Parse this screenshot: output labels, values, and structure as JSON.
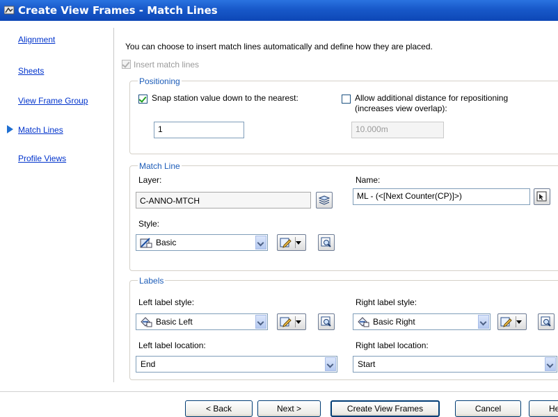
{
  "window": {
    "title": "Create View Frames - Match Lines"
  },
  "nav": {
    "items": [
      {
        "label": "Alignment"
      },
      {
        "label": "Sheets"
      },
      {
        "label": "View Frame Group"
      },
      {
        "label": "Match Lines"
      },
      {
        "label": "Profile Views"
      }
    ],
    "active": "Match Lines"
  },
  "intro": "You can choose to insert match lines automatically and define how they are placed.",
  "insert_match_lines": {
    "label": "Insert match lines",
    "checked": true,
    "enabled": false
  },
  "positioning": {
    "legend": "Positioning",
    "snap": {
      "label": "Snap station value down to the nearest:",
      "checked": true,
      "value": "1"
    },
    "allow": {
      "label_line1": "Allow additional distance for repositioning",
      "label_line2": "(increases view overlap):",
      "checked": false,
      "value": "10.000m"
    }
  },
  "match_line": {
    "legend": "Match Line",
    "layer_label": "Layer:",
    "layer_value": "C-ANNO-MTCH",
    "name_label": "Name:",
    "name_value": "ML - (<[Next Counter(CP)]>)",
    "style_label": "Style:",
    "style_value": "Basic"
  },
  "labels": {
    "legend": "Labels",
    "left_style_label": "Left label style:",
    "left_style_value": "Basic Left",
    "right_style_label": "Right label style:",
    "right_style_value": "Basic Right",
    "left_location_label": "Left label location:",
    "left_location_value": "End",
    "right_location_label": "Right label location:",
    "right_location_value": "Start"
  },
  "buttons": {
    "back": "< Back",
    "next": "Next >",
    "create": "Create View Frames",
    "cancel": "Cancel",
    "help": "Help"
  },
  "colors": {
    "titlebar": "#1858c9",
    "link": "#0033cc",
    "group_legend": "#1c5cb8",
    "nav_arrow": "#1f6fd1"
  }
}
